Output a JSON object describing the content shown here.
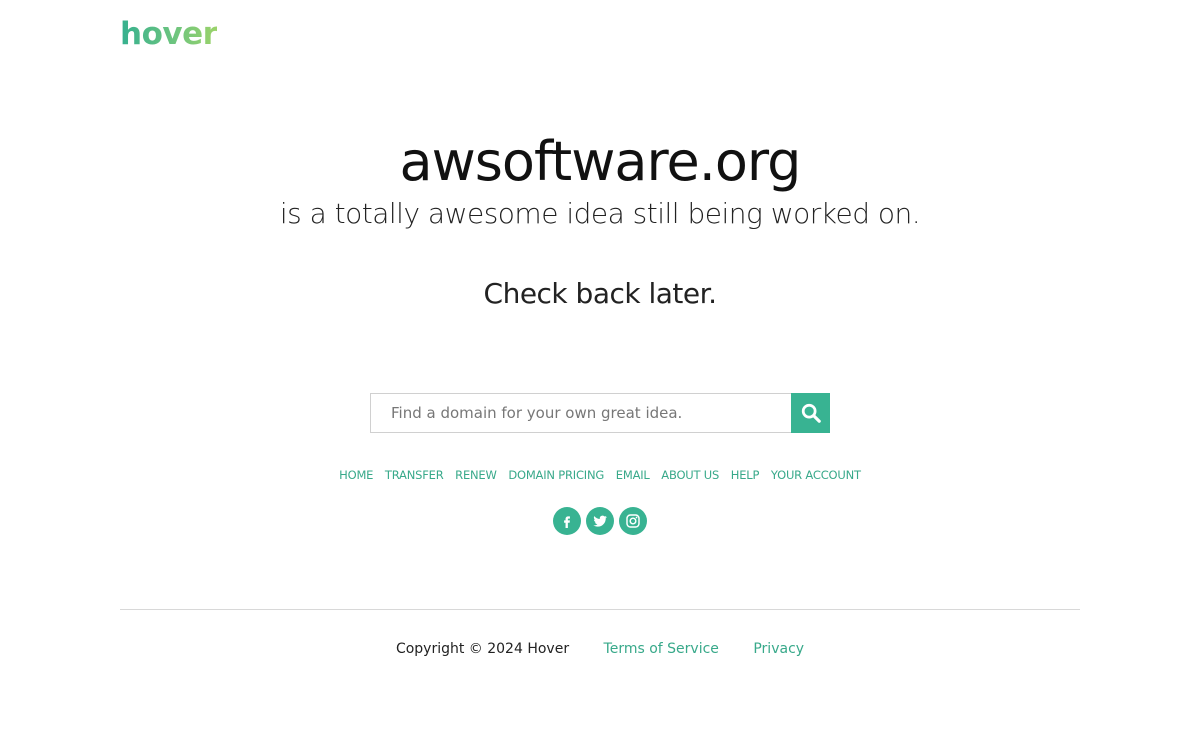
{
  "header": {
    "logo_text": "hover"
  },
  "hero": {
    "domain": "awsoftware.org",
    "tagline": "is a totally awesome idea still being worked on.",
    "check_back": "Check back later."
  },
  "search": {
    "placeholder": "Find a domain for your own great idea.",
    "value": "",
    "button_icon": "search-icon"
  },
  "nav": {
    "items": [
      {
        "label": "HOME"
      },
      {
        "label": "TRANSFER"
      },
      {
        "label": "RENEW"
      },
      {
        "label": "DOMAIN PRICING"
      },
      {
        "label": "EMAIL"
      },
      {
        "label": "ABOUT US"
      },
      {
        "label": "HELP"
      },
      {
        "label": "YOUR ACCOUNT"
      }
    ]
  },
  "social": {
    "icons": [
      "facebook-icon",
      "twitter-icon",
      "instagram-icon"
    ]
  },
  "footer": {
    "copyright": "Copyright © 2024 Hover",
    "terms_label": "Terms of Service",
    "privacy_label": "Privacy"
  },
  "colors": {
    "accent": "#38b392",
    "link": "#38a98a",
    "text": "#222222"
  }
}
